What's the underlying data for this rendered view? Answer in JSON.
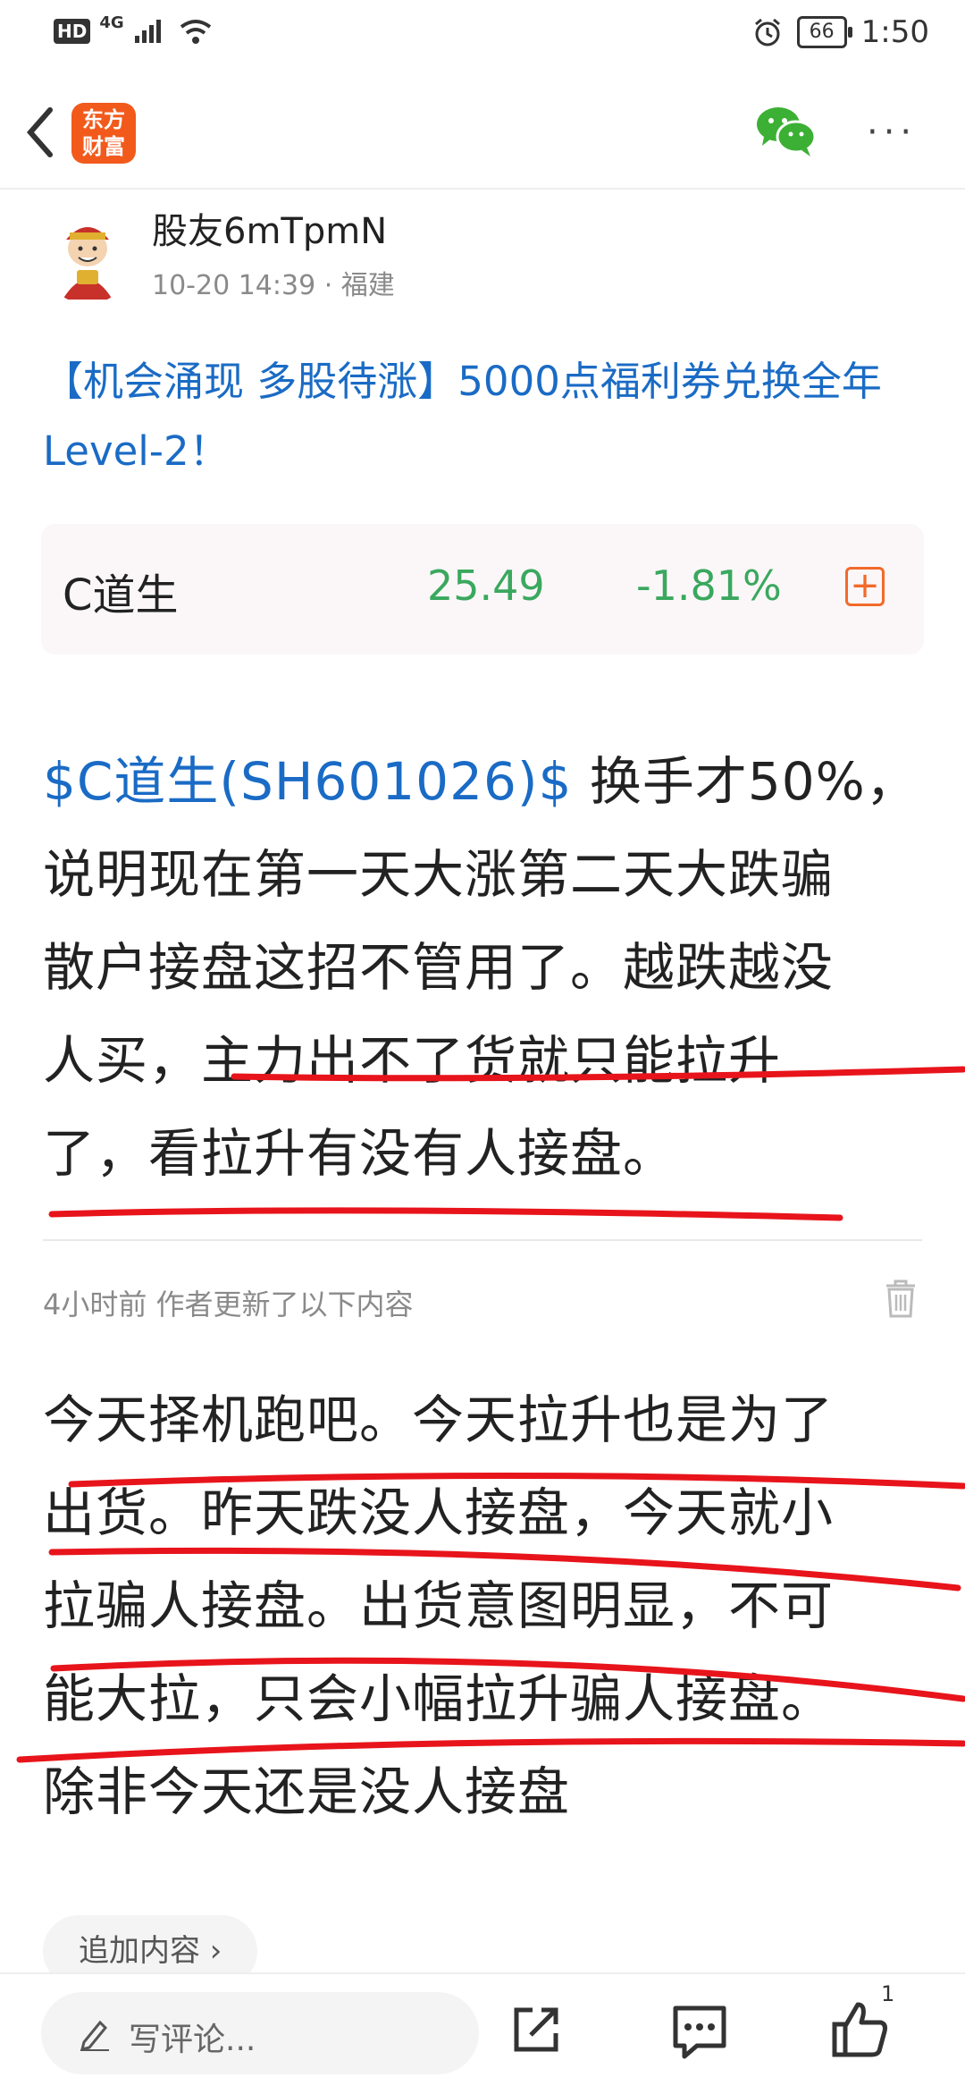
{
  "status_bar": {
    "left_badge": "HD",
    "network": "4G",
    "battery": "66",
    "time": "1:50"
  },
  "nav": {
    "logo_line1": "东方",
    "logo_line2": "财富",
    "icons": [
      "back-icon",
      "wechat-icon",
      "more-icon"
    ],
    "more": "···"
  },
  "author": {
    "name": "股友6mTpmN",
    "meta": "10-20 14:39 · 福建"
  },
  "promo": "【机会涌现 多股待涨】5000点福利券兑换全年Level-2！",
  "stock_card": {
    "name": "C道生",
    "price": "25.49",
    "change": "-1.81%",
    "add_symbol": "+",
    "change_color": "#3aa85e"
  },
  "post": {
    "stock_tag": "$C道生(SH601026)$",
    "lines": [
      " 换手才50%，",
      "说明现在第一天大涨第二天大跌骗",
      "散户接盘这招不管用了。越跌越没",
      "人买，主力出不了货就只能拉升",
      "了，看拉升有没有人接盘。"
    ]
  },
  "update": {
    "meta": "4小时前  作者更新了以下内容",
    "lines": [
      "今天择机跑吧。今天拉升也是为了",
      "出货。昨天跌没人接盘，今天就小",
      "拉骗人接盘。出货意图明显，不可",
      "能大拉，只会小幅拉升骗人接盘。",
      "除非今天还是没人接盘"
    ]
  },
  "append_label": "追加内容 ›",
  "bottom_bar": {
    "comment_placeholder": "写评论...",
    "like_count": "1"
  },
  "colors": {
    "brand": "#f25a1c",
    "link": "#1a6bc5",
    "annotation": "#e8141b"
  }
}
